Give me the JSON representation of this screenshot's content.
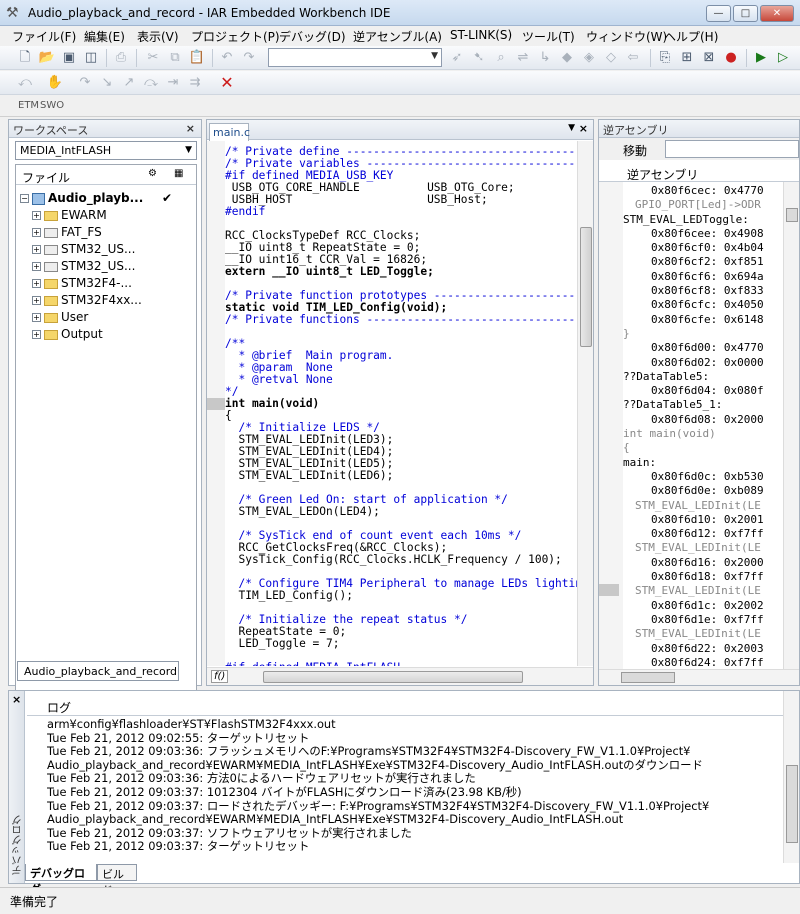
{
  "window": {
    "title": "Audio_playback_and_record - IAR Embedded Workbench IDE",
    "min": "—",
    "max": "□",
    "close": "✕"
  },
  "menu": [
    "ファイル(F)",
    "編集(E)",
    "表示(V)",
    "プロジェクト(P)",
    "デバッグ(D)",
    "逆アセンブル(A)",
    "ST-LINK(S)",
    "ツール(T)",
    "ウィンドウ(W)",
    "ヘルプ(H)"
  ],
  "etm": {
    "etm": "ETM",
    "swo": "SWO"
  },
  "workspace": {
    "title": "ワークスペース",
    "config": "MEDIA_IntFLASH",
    "files_header": "ファイル",
    "project": "Audio_playb...",
    "project_check": "✔",
    "groups": [
      {
        "name": "EWARM",
        "kind": "folder"
      },
      {
        "name": "FAT_FS",
        "kind": "file"
      },
      {
        "name": "STM32_US...",
        "kind": "file"
      },
      {
        "name": "STM32_US...",
        "kind": "file"
      },
      {
        "name": "STM32F4-...",
        "kind": "folder"
      },
      {
        "name": "STM32F4xx...",
        "kind": "folder"
      },
      {
        "name": "User",
        "kind": "folder"
      },
      {
        "name": "Output",
        "kind": "folder"
      }
    ],
    "tab": "Audio_playback_and_record"
  },
  "editor": {
    "tab": "main.c",
    "lines": [
      {
        "t": "/* Private define ------------------------------------------------------------*/",
        "s": "c"
      },
      {
        "t": "/* Private variables ---------------------------------------------------------*/",
        "s": "c"
      },
      {
        "t": "#if defined MEDIA_USB_KEY",
        "s": "c"
      },
      {
        "t": " USB_OTG_CORE_HANDLE          USB_OTG_Core;",
        "s": ""
      },
      {
        "t": " USBH_HOST                    USB_Host;",
        "s": ""
      },
      {
        "t": "#endif",
        "s": "c"
      },
      {
        "t": "",
        "s": ""
      },
      {
        "t": "RCC_ClocksTypeDef RCC_Clocks;",
        "s": ""
      },
      {
        "t": "__IO uint8_t RepeatState = 0;",
        "s": ""
      },
      {
        "t": "__IO uint16_t CCR_Val = 16826;",
        "s": ""
      },
      {
        "t": "extern __IO uint8_t LED_Toggle;",
        "s": "k"
      },
      {
        "t": "",
        "s": ""
      },
      {
        "t": "/* Private function prototypes -----------------------------------------------*/",
        "s": "c"
      },
      {
        "t": "static void TIM_LED_Config(void);",
        "s": "k"
      },
      {
        "t": "/* Private functions ---------------------------------------------------------*/",
        "s": "c"
      },
      {
        "t": "",
        "s": ""
      },
      {
        "t": "/**",
        "s": "c"
      },
      {
        "t": "  * @brief  Main program.",
        "s": "c"
      },
      {
        "t": "  * @param  None",
        "s": "c"
      },
      {
        "t": "  * @retval None",
        "s": "c"
      },
      {
        "t": "*/",
        "s": "c"
      },
      {
        "t": "int main(void)",
        "s": "k"
      },
      {
        "t": "{",
        "s": ""
      },
      {
        "t": "  /* Initialize LEDS */",
        "s": "c"
      },
      {
        "t": "  STM_EVAL_LEDInit(LED3);",
        "s": ""
      },
      {
        "t": "  STM_EVAL_LEDInit(LED4);",
        "s": ""
      },
      {
        "t": "  STM_EVAL_LEDInit(LED5);",
        "s": ""
      },
      {
        "t": "  STM_EVAL_LEDInit(LED6);",
        "s": ""
      },
      {
        "t": "",
        "s": ""
      },
      {
        "t": "  /* Green Led On: start of application */",
        "s": "c"
      },
      {
        "t": "  STM_EVAL_LEDOn(LED4);",
        "s": ""
      },
      {
        "t": "",
        "s": ""
      },
      {
        "t": "  /* SysTick end of count event each 10ms */",
        "s": "c"
      },
      {
        "t": "  RCC_GetClocksFreq(&RCC_Clocks);",
        "s": ""
      },
      {
        "t": "  SysTick_Config(RCC_Clocks.HCLK_Frequency / 100);",
        "s": ""
      },
      {
        "t": "",
        "s": ""
      },
      {
        "t": "  /* Configure TIM4 Peripheral to manage LEDs lighting */",
        "s": "c"
      },
      {
        "t": "  TIM_LED_Config();",
        "s": ""
      },
      {
        "t": "",
        "s": ""
      },
      {
        "t": "  /* Initialize the repeat status */",
        "s": "c"
      },
      {
        "t": "  RepeatState = 0;",
        "s": ""
      },
      {
        "t": "  LED_Toggle = 7;",
        "s": ""
      },
      {
        "t": "",
        "s": ""
      },
      {
        "t": "#if defined MEDIA_IntFLASH",
        "s": "c"
      }
    ],
    "fo": "f()"
  },
  "disasm": {
    "title": "逆アセンブリ",
    "goto_label": "移動",
    "header": "逆アセンブリ",
    "lines": [
      {
        "t": "0x80f6cec: 0x4770",
        "s": "d0"
      },
      {
        "t": "GPIO_PORT[Led]->ODR",
        "s": "d1"
      },
      {
        "t": "STM_EVAL_LEDToggle:",
        "s": "d3"
      },
      {
        "t": "0x80f6cee: 0x4908",
        "s": "d0"
      },
      {
        "t": "0x80f6cf0: 0x4b04",
        "s": "d0"
      },
      {
        "t": "0x80f6cf2: 0xf851",
        "s": "d0"
      },
      {
        "t": "0x80f6cf6: 0x694a",
        "s": "d0"
      },
      {
        "t": "0x80f6cf8: 0xf833",
        "s": "d0"
      },
      {
        "t": "0x80f6cfc: 0x4050",
        "s": "d0"
      },
      {
        "t": "0x80f6cfe: 0x6148",
        "s": "d0"
      },
      {
        "t": "}",
        "s": "d2"
      },
      {
        "t": "0x80f6d00: 0x4770",
        "s": "d0"
      },
      {
        "t": "0x80f6d02: 0x0000",
        "s": "d0"
      },
      {
        "t": "??DataTable5:",
        "s": "d3"
      },
      {
        "t": "0x80f6d04: 0x080f",
        "s": "d0"
      },
      {
        "t": "??DataTable5_1:",
        "s": "d3"
      },
      {
        "t": "0x80f6d08: 0x2000",
        "s": "d0"
      },
      {
        "t": "int main(void)",
        "s": "d2"
      },
      {
        "t": "{",
        "s": "d2"
      },
      {
        "t": "main:",
        "s": "d3"
      },
      {
        "t": "0x80f6d0c: 0xb530",
        "s": "d0"
      },
      {
        "t": "0x80f6d0e: 0xb089",
        "s": "d0"
      },
      {
        "t": "STM_EVAL_LEDInit(LE",
        "s": "d1"
      },
      {
        "t": "0x80f6d10: 0x2001",
        "s": "d0"
      },
      {
        "t": "0x80f6d12: 0xf7ff",
        "s": "d0"
      },
      {
        "t": "STM_EVAL_LEDInit(LE",
        "s": "d1"
      },
      {
        "t": "0x80f6d16: 0x2000",
        "s": "d0"
      },
      {
        "t": "0x80f6d18: 0xf7ff",
        "s": "d0"
      },
      {
        "t": "STM_EVAL_LEDInit(LE",
        "s": "d1"
      },
      {
        "t": "0x80f6d1c: 0x2002",
        "s": "d0"
      },
      {
        "t": "0x80f6d1e: 0xf7ff",
        "s": "d0"
      },
      {
        "t": "STM_EVAL_LEDInit(LE",
        "s": "d1"
      },
      {
        "t": "0x80f6d22: 0x2003",
        "s": "d0"
      },
      {
        "t": "0x80f6d24: 0xf7ff",
        "s": "d0"
      },
      {
        "t": "STM_EVAL_LEDOn(LED",
        "s": "d1"
      }
    ]
  },
  "log": {
    "side_label": "デバッグログ",
    "header": "ログ",
    "lines": [
      "arm¥config¥flashloader¥ST¥FlashSTM32F4xxx.out",
      "Tue Feb 21, 2012 09:02:55: ターゲットリセット",
      "Tue Feb 21, 2012 09:03:36: フラッシュメモリへのF:¥Programs¥STM32F4¥STM32F4-Discovery_FW_V1.1.0¥Project¥",
      "Audio_playback_and_record¥EWARM¥MEDIA_IntFLASH¥Exe¥STM32F4-Discovery_Audio_IntFLASH.outのダウンロード",
      "Tue Feb 21, 2012 09:03:36: 方法0によるハードウェアリセットが実行されました",
      "Tue Feb 21, 2012 09:03:37: 1012304 バイトがFLASHにダウンロード済み(23.98 KB/秒)",
      "Tue Feb 21, 2012 09:03:37: ロードされたデバッギー: F:¥Programs¥STM32F4¥STM32F4-Discovery_FW_V1.1.0¥Project¥",
      "Audio_playback_and_record¥EWARM¥MEDIA_IntFLASH¥Exe¥STM32F4-Discovery_Audio_IntFLASH.out",
      "Tue Feb 21, 2012 09:03:37: ソフトウェアリセットが実行されました",
      "Tue Feb 21, 2012 09:03:37: ターゲットリセット"
    ],
    "tabs": [
      "デバッグログ",
      "ビルド"
    ]
  },
  "status": "準備完了"
}
